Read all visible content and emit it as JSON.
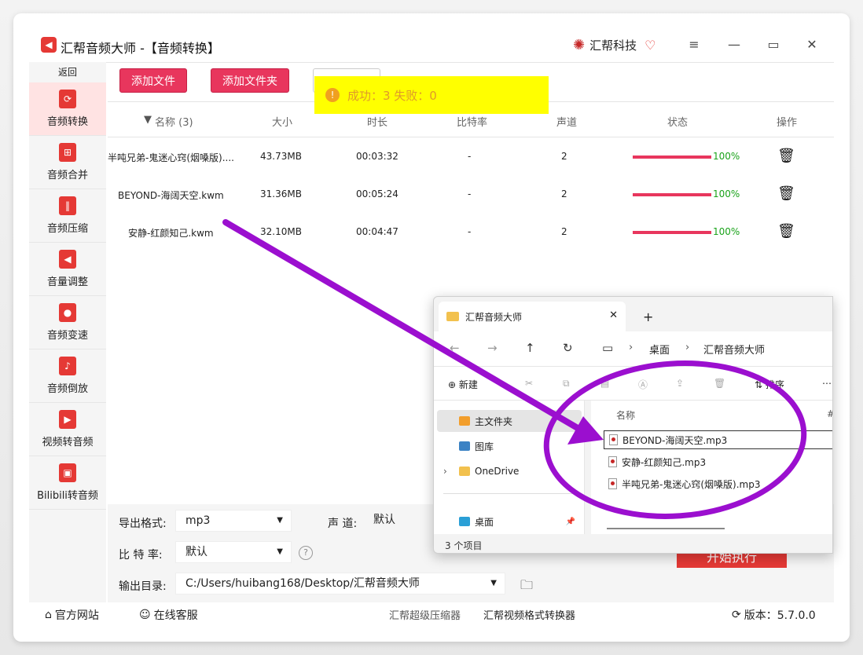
{
  "app": {
    "title": "汇帮音频大师  -【音频转换】",
    "brand": "汇帮科技",
    "logo_icon": "speaker-icon"
  },
  "sidebar": {
    "back": "返回",
    "items": [
      {
        "label": "音频转换",
        "icon": "audio-convert-icon",
        "active": true
      },
      {
        "label": "音频合并",
        "icon": "audio-merge-icon",
        "active": false
      },
      {
        "label": "音频压缩",
        "icon": "audio-compress-icon",
        "active": false
      },
      {
        "label": "音量调整",
        "icon": "volume-icon",
        "active": false
      },
      {
        "label": "音频变速",
        "icon": "microphone-icon",
        "active": false
      },
      {
        "label": "音频倒放",
        "icon": "music-note-icon",
        "active": false
      },
      {
        "label": "视频转音频",
        "icon": "film-icon",
        "active": false
      },
      {
        "label": "Bilibili转音频",
        "icon": "tv-icon",
        "active": false
      }
    ]
  },
  "toolbar": {
    "add_file": "添加文件",
    "add_folder": "添加文件夹"
  },
  "toast": {
    "text": "成功：3    失败：0"
  },
  "table": {
    "headers": {
      "name": "名称 (3)",
      "size": "大小",
      "duration": "时长",
      "bitrate": "比特率",
      "channels": "声道",
      "status": "状态",
      "action": "操作"
    },
    "rows": [
      {
        "name": "半吨兄弟-鬼迷心窍(烟嗓版)....",
        "size": "43.73MB",
        "duration": "00:03:32",
        "bitrate": "-",
        "channels": "2",
        "progress": 1.0,
        "pct": "100%"
      },
      {
        "name": "BEYOND-海阔天空.kwm",
        "size": "31.36MB",
        "duration": "00:05:24",
        "bitrate": "-",
        "channels": "2",
        "progress": 1.0,
        "pct": "100%"
      },
      {
        "name": "安静-红颜知己.kwm",
        "size": "32.10MB",
        "duration": "00:04:47",
        "bitrate": "-",
        "channels": "2",
        "progress": 1.0,
        "pct": "100%"
      }
    ]
  },
  "settings": {
    "format_label": "导出格式:",
    "format_value": "mp3",
    "channel_label": "声 道:",
    "channel_value": "默认",
    "bitrate_label": "比 特 率:",
    "bitrate_value": "默认",
    "help": "?",
    "output_label": "输出目录:",
    "output_value": "C:/Users/huibang168/Desktop/汇帮音频大师",
    "start": "开始执行"
  },
  "footer": {
    "website": "官方网站",
    "service": "在线客服",
    "link1": "汇帮超级压缩器",
    "link2": "汇帮视频格式转换器",
    "version": "版本：5.7.0.0"
  },
  "explorer": {
    "tab_title": "汇帮音频大师",
    "breadcrumb1": "桌面",
    "breadcrumb2": "汇帮音频大师",
    "new_label": "新建",
    "sort_label": "排序",
    "nav": [
      "主文件夹",
      "图库",
      "OneDrive",
      "桌面"
    ],
    "col_name": "名称",
    "col_hash": "#",
    "files": [
      "BEYOND-海阔天空.mp3",
      "安静-红颜知己.mp3",
      "半吨兄弟-鬼迷心窍(烟嗓版).mp3"
    ],
    "status": "3 个项目"
  },
  "colors": {
    "accent": "#e8365d",
    "toast_bg": "#ffff00",
    "progress_text": "#1aa31a",
    "annotation": "#9b0fcf"
  }
}
